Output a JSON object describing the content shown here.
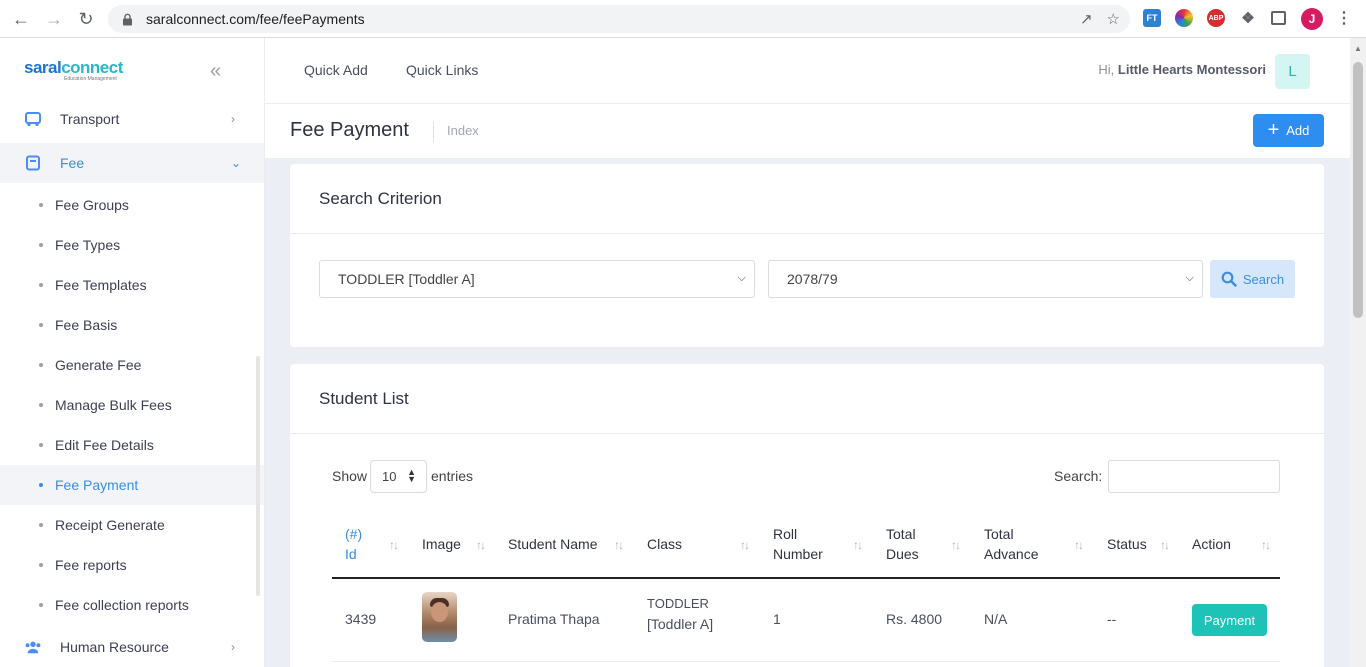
{
  "browser": {
    "url": "saralconnect.com/fee/feePayments",
    "profile_initial": "J",
    "ext_abp": "ABP",
    "ext_ft": "FT"
  },
  "logo": {
    "text_a": "saral",
    "text_b": "connect",
    "tagline": "Education Management"
  },
  "sidebar": {
    "items": [
      {
        "label": "Transport"
      },
      {
        "label": "Fee"
      },
      {
        "label": "Human Resource"
      }
    ],
    "sub_items": [
      {
        "label": "Fee Groups"
      },
      {
        "label": "Fee Types"
      },
      {
        "label": "Fee Templates"
      },
      {
        "label": "Fee Basis"
      },
      {
        "label": "Generate Fee"
      },
      {
        "label": "Manage Bulk Fees"
      },
      {
        "label": "Edit Fee Details"
      },
      {
        "label": "Fee Payment"
      },
      {
        "label": "Receipt Generate"
      },
      {
        "label": "Fee reports"
      },
      {
        "label": "Fee collection reports"
      }
    ]
  },
  "topbar": {
    "quick_add": "Quick Add",
    "quick_links": "Quick Links",
    "greeting_prefix": "Hi,",
    "user_name": "Little Hearts Montessori",
    "avatar_initial": "L"
  },
  "page": {
    "title": "Fee Payment",
    "breadcrumb": "Index",
    "add_label": "Add"
  },
  "search_card": {
    "title": "Search Criterion",
    "class_value": "TODDLER [Toddler A]",
    "year_value": "2078/79",
    "search_label": "Search"
  },
  "student_card": {
    "title": "Student List",
    "show_label": "Show",
    "entries_value": "10",
    "entries_label": "entries",
    "search_label": "Search:",
    "columns": {
      "id_a": "(#)",
      "id_b": "Id",
      "image": "Image",
      "student_name": "Student Name",
      "class": "Class",
      "roll_a": "Roll",
      "roll_b": "Number",
      "dues_a": "Total",
      "dues_b": "Dues",
      "adv_a": "Total",
      "adv_b": "Advance",
      "status": "Status",
      "action": "Action"
    },
    "rows": [
      {
        "id": "3439",
        "student_name": "Pratima Thapa",
        "class_a": "TODDLER",
        "class_b": "[Toddler A]",
        "roll": "1",
        "dues": "Rs. 4800",
        "advance": "N/A",
        "status": "--",
        "action": "Payment"
      }
    ]
  },
  "colors": {
    "accent": "#3c8dde",
    "add_button": "#2d8ef0",
    "payment_button": "#1ec3b8",
    "content_bg": "#eceef6"
  }
}
